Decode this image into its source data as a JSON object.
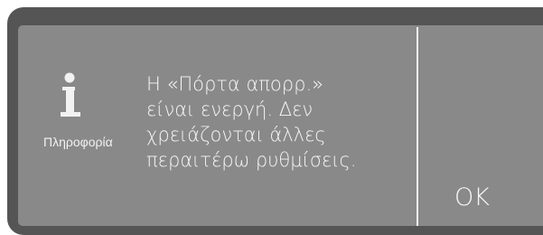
{
  "dialog": {
    "icon": "info-icon",
    "icon_caption": "Πληροφορία",
    "message": "Η «Πόρτα απορρ.»\nείναι ενεργή. Δεν\nχρειάζονται άλλες\nπεραιτέρω ρυθμίσεις.",
    "ok_label": "OK"
  },
  "colors": {
    "bezel": "#555555",
    "panel": "#898989",
    "text": "#f7f7f7"
  }
}
